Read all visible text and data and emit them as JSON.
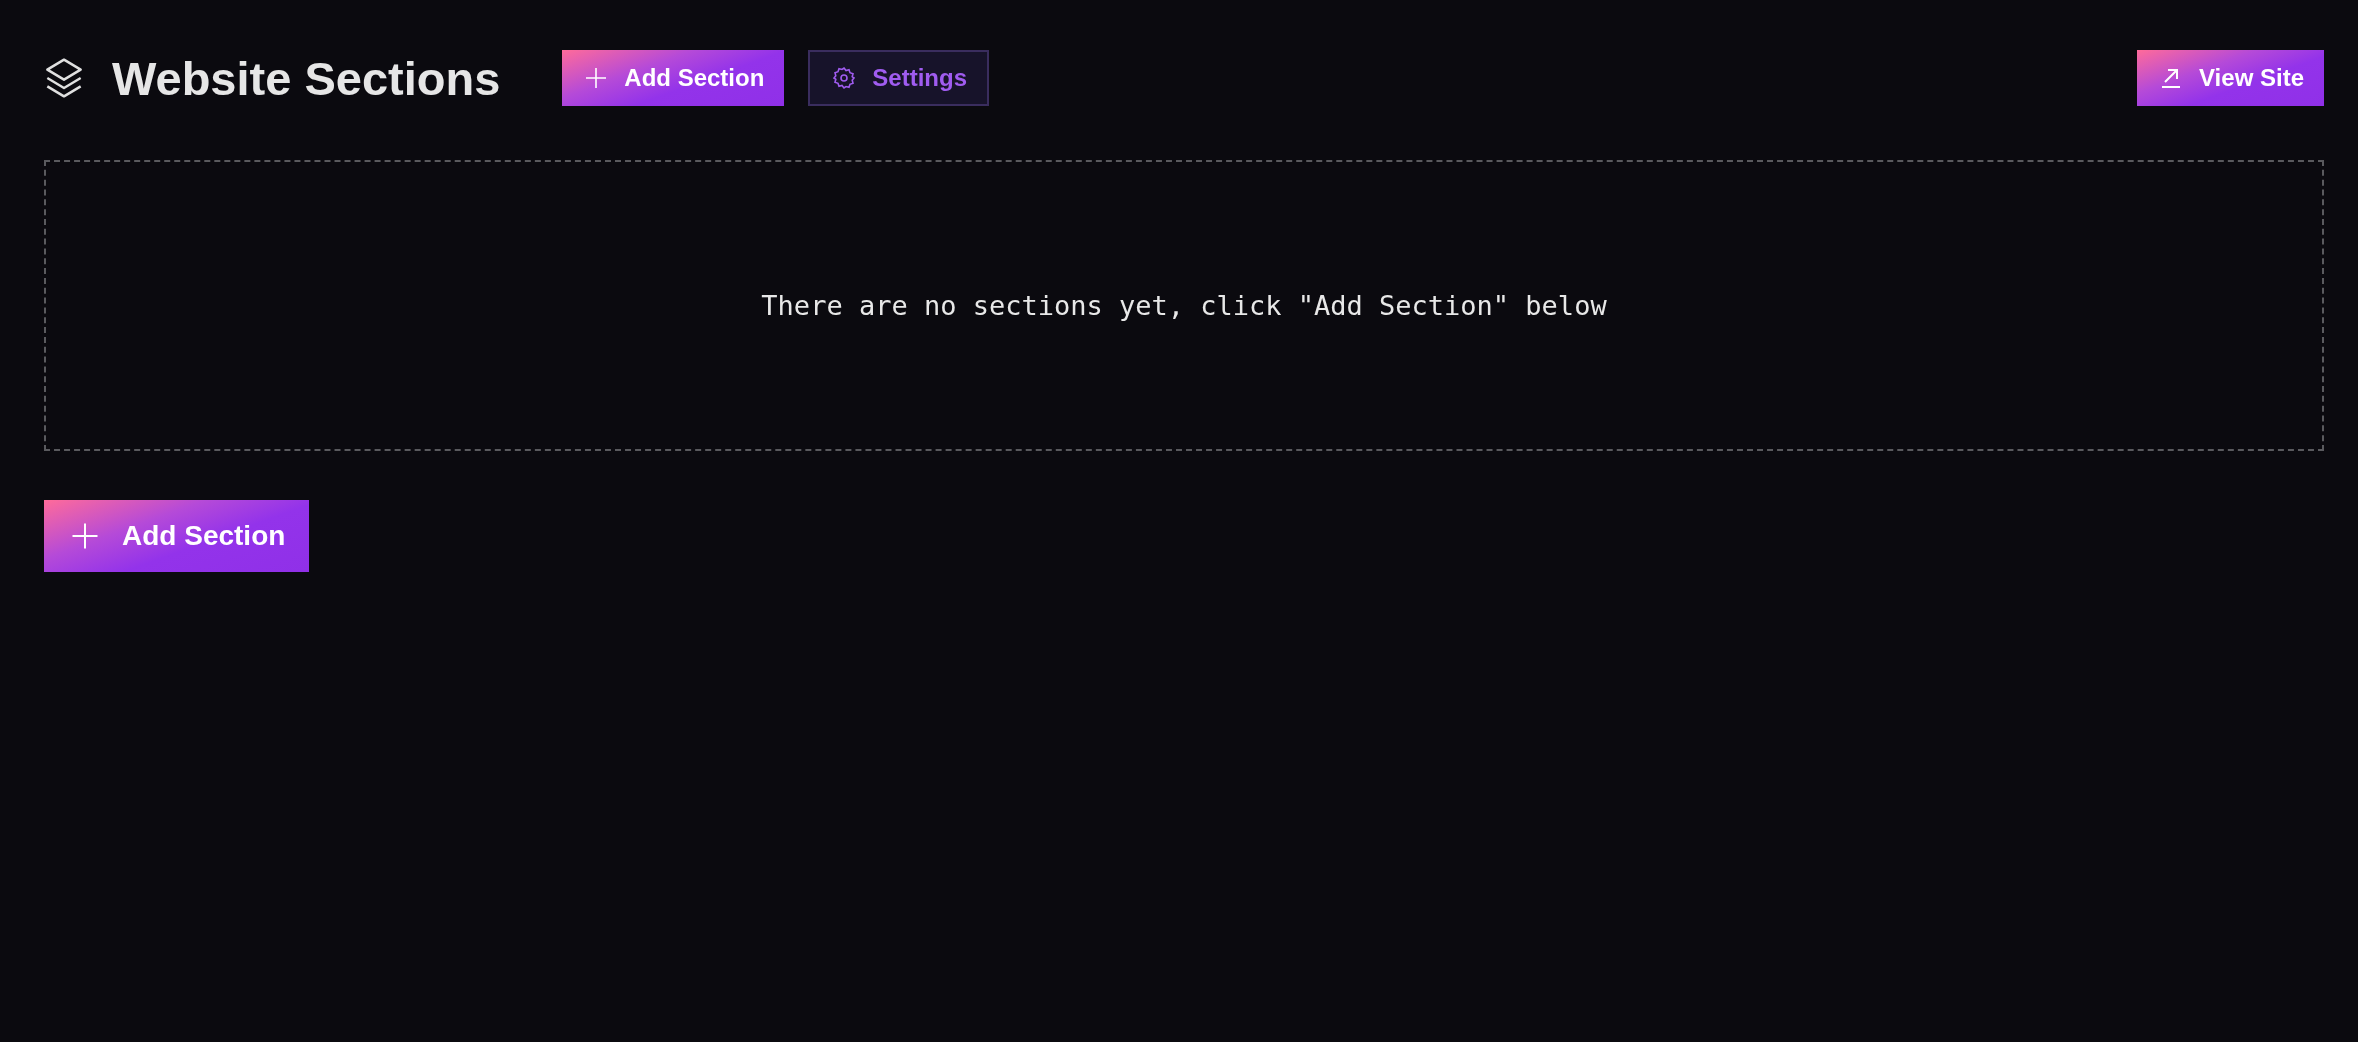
{
  "header": {
    "title": "Website Sections",
    "actions": [
      {
        "kind": "primary",
        "label": "Add Section"
      },
      {
        "kind": "secondary",
        "label": "Settings"
      }
    ],
    "view_site": {
      "kind": "primary",
      "label": "View Site"
    }
  },
  "empty_state": {
    "message": "There are no sections yet, click \"Add Section\" below"
  },
  "add_button": {
    "kind": "primary",
    "label": "Add Section"
  }
}
